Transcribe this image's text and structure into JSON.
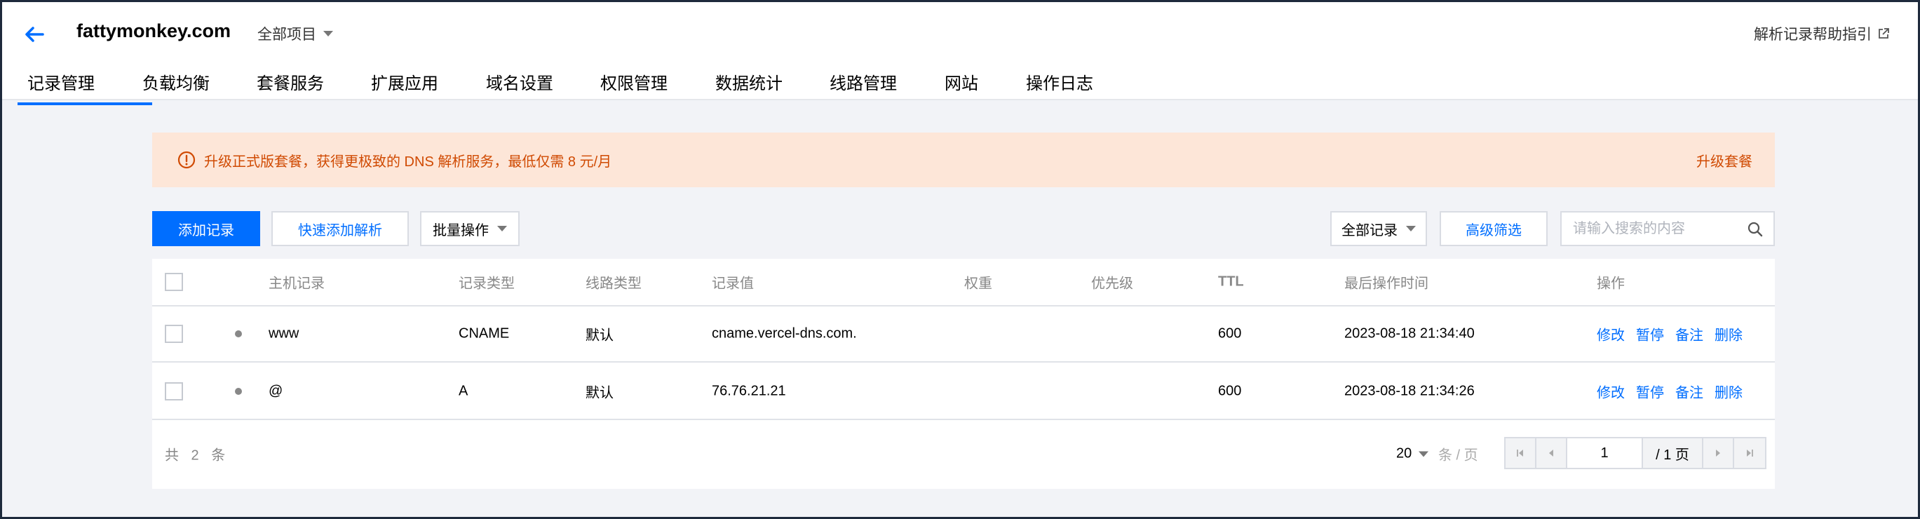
{
  "header": {
    "domain": "fattymonkey.com",
    "project_select": "全部项目",
    "help_link": "解析记录帮助指引"
  },
  "tabs": [
    {
      "label": "记录管理",
      "active": true
    },
    {
      "label": "负载均衡"
    },
    {
      "label": "套餐服务"
    },
    {
      "label": "扩展应用"
    },
    {
      "label": "域名设置"
    },
    {
      "label": "权限管理"
    },
    {
      "label": "数据统计"
    },
    {
      "label": "线路管理"
    },
    {
      "label": "网站"
    },
    {
      "label": "操作日志"
    }
  ],
  "banner": {
    "text": "升级正式版套餐，获得更极致的 DNS 解析服务，最低仅需 8 元/月",
    "action": "升级套餐"
  },
  "toolbar": {
    "add_record": "添加记录",
    "quick_add": "快速添加解析",
    "batch": "批量操作",
    "filter_select": "全部记录",
    "advanced_filter": "高级筛选",
    "search_placeholder": "请输入搜索的内容"
  },
  "table": {
    "columns": {
      "host": "主机记录",
      "type": "记录类型",
      "line": "线路类型",
      "value": "记录值",
      "weight": "权重",
      "priority": "优先级",
      "ttl": "TTL",
      "updated": "最后操作时间",
      "actions": "操作"
    },
    "rows": [
      {
        "host": "www",
        "type": "CNAME",
        "line": "默认",
        "value": "cname.vercel-dns.com.",
        "weight": "",
        "priority": "",
        "ttl": "600",
        "updated": "2023-08-18 21:34:40"
      },
      {
        "host": "@",
        "type": "A",
        "line": "默认",
        "value": "76.76.21.21",
        "weight": "",
        "priority": "",
        "ttl": "600",
        "updated": "2023-08-18 21:34:26"
      }
    ],
    "row_actions": {
      "edit": "修改",
      "pause": "暂停",
      "remark": "备注",
      "delete": "删除"
    }
  },
  "pagination": {
    "total": "共 2 条",
    "page_size": "20",
    "page_size_unit": "条 / 页",
    "current_page": "1",
    "total_pages": "/ 1 页"
  },
  "colors": {
    "accent": "#006eff",
    "warning_text": "#d04a02",
    "warning_bg": "#fde6d8"
  }
}
